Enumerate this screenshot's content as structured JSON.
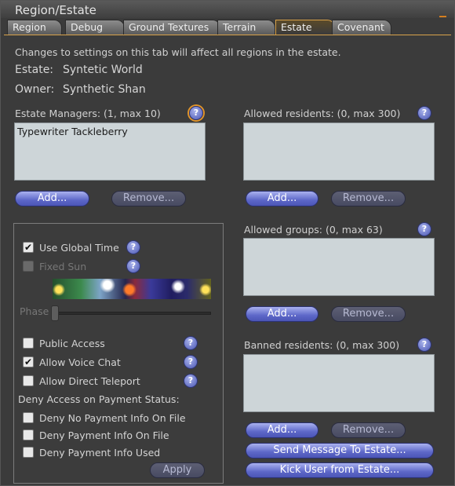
{
  "window": {
    "title": "Region/Estate",
    "minimize_glyph": "_"
  },
  "tabs": [
    {
      "label": "Region",
      "active": false
    },
    {
      "label": "Debug",
      "active": false
    },
    {
      "label": "Ground Textures",
      "active": false
    },
    {
      "label": "Terrain",
      "active": false
    },
    {
      "label": "Estate",
      "active": true
    },
    {
      "label": "Covenant",
      "active": false
    }
  ],
  "estate": {
    "notice": "Changes to settings on this tab will affect all regions in the estate.",
    "estate_label": "Estate:",
    "estate_value": "Syntetic World",
    "owner_label": "Owner:",
    "owner_value": "Synthetic Shan"
  },
  "managers": {
    "label": "Estate Managers: (1, max 10)",
    "items": [
      "Typewriter Tackleberry"
    ],
    "add": "Add...",
    "remove": "Remove..."
  },
  "allowed_residents": {
    "label": "Allowed residents: (0, max 300)",
    "items": [],
    "add": "Add...",
    "remove": "Remove..."
  },
  "allowed_groups": {
    "label": "Allowed groups: (0, max 63)",
    "items": [],
    "add": "Add...",
    "remove": "Remove..."
  },
  "banned_residents": {
    "label": "Banned residents: (0, max 300)",
    "items": [],
    "add": "Add...",
    "remove": "Remove..."
  },
  "help_glyph": "?",
  "time": {
    "use_global_time": {
      "label": "Use Global Time",
      "checked": true
    },
    "fixed_sun": {
      "label": "Fixed Sun",
      "checked": false,
      "disabled": true
    },
    "phase_label": "Phase",
    "phase_level": 0.0
  },
  "access": {
    "public_access": {
      "label": "Public Access",
      "checked": false
    },
    "allow_voice_chat": {
      "label": "Allow Voice Chat",
      "checked": true
    },
    "allow_direct_teleport": {
      "label": "Allow Direct Teleport",
      "checked": false
    },
    "deny_heading": "Deny Access on Payment Status:",
    "deny_no_payment": {
      "label": "Deny No Payment Info On File",
      "checked": false
    },
    "deny_payment_on_file": {
      "label": "Deny Payment Info On File",
      "checked": false
    },
    "deny_payment_used": {
      "label": "Deny Payment Info Used",
      "checked": false
    },
    "apply": "Apply"
  },
  "actions": {
    "send_message": "Send Message To Estate...",
    "kick_user": "Kick User from Estate..."
  },
  "checkmark_glyph": "✔"
}
